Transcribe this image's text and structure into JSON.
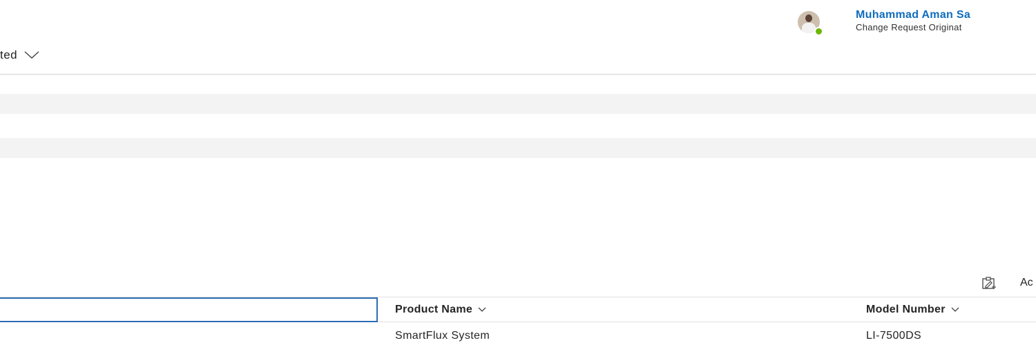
{
  "header": {
    "user": {
      "name": "Muhammad Aman Sa",
      "role": "Change Request Originat",
      "presence_color": "#6bb700"
    }
  },
  "view": {
    "label": "ted",
    "icon": "chevron-down-icon"
  },
  "commandbar": {
    "edit_icon": "edit-columns-icon",
    "action_label": "Ac"
  },
  "grid": {
    "columns": [
      {
        "label": "Product Name",
        "icon": "chevron-down-icon"
      },
      {
        "label": "Model Number",
        "icon": "chevron-down-icon"
      }
    ],
    "rows": [
      {
        "product_name": "SmartFlux System",
        "model_number": "LI-7500DS"
      }
    ]
  },
  "colors": {
    "accent": "#0f6cbd",
    "selection_border": "#2b6cb4",
    "placeholder": "#f3f3f3"
  }
}
